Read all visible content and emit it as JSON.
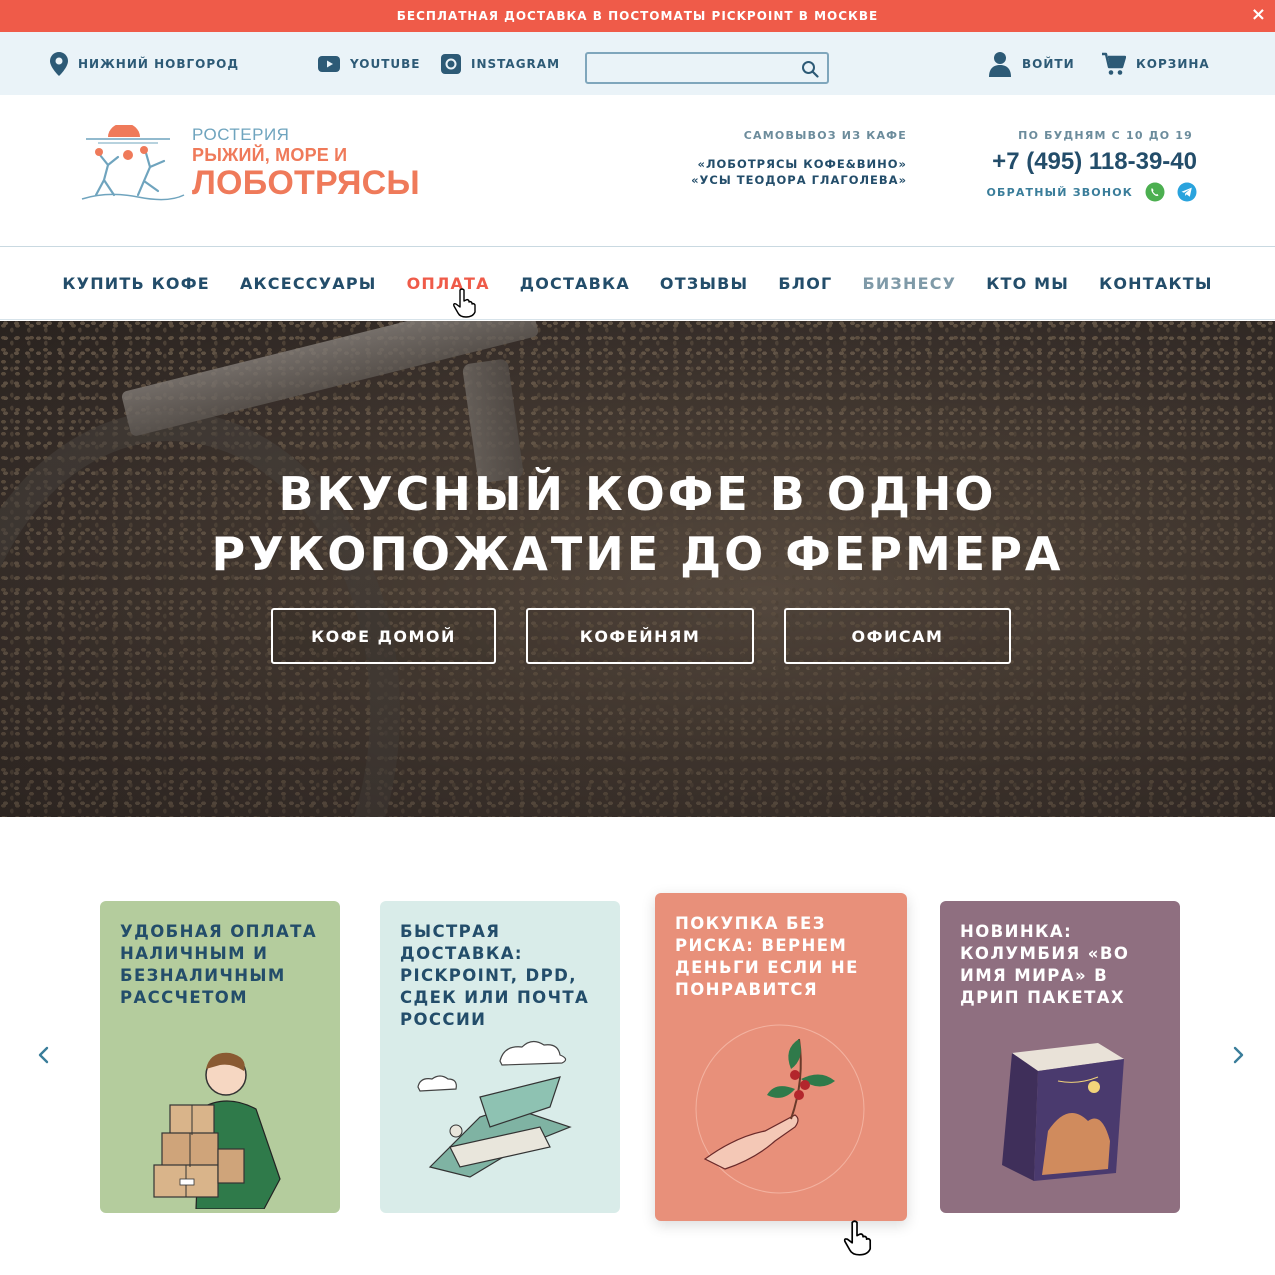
{
  "promo": {
    "text": "БЕСПЛАТНАЯ ДОСТАВКА В ПОСТОМАТЫ PICKPOINT В МОСКВЕ",
    "close": "×"
  },
  "topbar": {
    "city": "НИЖНИЙ НОВГОРОД",
    "youtube": "YOUTUBE",
    "instagram": "INSTAGRAM",
    "search_value": "",
    "login": "ВОЙТИ",
    "cart": "КОРЗИНА"
  },
  "header": {
    "logo_line1": "РОСТЕРИЯ",
    "logo_line2": "РЫЖИЙ, МОРЕ И",
    "logo_line3": "ЛОБОТРЯСЫ",
    "pickup_label": "САМОВЫВОЗ ИЗ КАФЕ",
    "cafe1": "«ЛОБОТРЯСЫ КОФЕ&ВИНО»",
    "cafe2": "«УСЫ ТЕОДОРА ГЛАГОЛЕВА»",
    "hours": "ПО БУДНЯМ С 10 ДО 19",
    "phone": "+7 (495) 118-39-40",
    "callback": "ОБРАТНЫЙ ЗВОНОК"
  },
  "nav": [
    "КУПИТЬ КОФЕ",
    "АКСЕССУАРЫ",
    "ОПЛАТА",
    "ДОСТАВКА",
    "ОТЗЫВЫ",
    "БЛОГ",
    "БИЗНЕСУ",
    "КТО МЫ",
    "КОНТАКТЫ"
  ],
  "hero": {
    "title_line1": "ВКУСНЫЙ КОФЕ В ОДНО",
    "title_line2": "РУКОПОЖАТИЕ ДО ФЕРМЕРА",
    "buttons": [
      "КОФЕ ДОМОЙ",
      "КОФЕЙНЯМ",
      "ОФИСАМ"
    ]
  },
  "cards": [
    {
      "title": "Удобная оплата наличным и безналичным рассчетом",
      "bg": "#b4cc9d",
      "fg": "#234d6a"
    },
    {
      "title": "Быстрая доставка: PickPoint, DPD, СДЕК или Почта России",
      "bg": "#d9ece9",
      "fg": "#234d6a"
    },
    {
      "title": "Покупка без риска: вернем деньги если не понравится",
      "bg": "#e8907a",
      "fg": "#ffffff"
    },
    {
      "title": "Новинка: Колумбия «Во имя мира» в дрип пакетах",
      "bg": "#8f6f80",
      "fg": "#ffffff"
    }
  ],
  "colors": {
    "accent": "#ef5b49",
    "primary": "#234d6a",
    "topbar_bg": "#eaf3f8"
  },
  "icons": [
    "location-pin-icon",
    "youtube-icon",
    "instagram-icon",
    "search-icon",
    "user-icon",
    "cart-icon",
    "whatsapp-icon",
    "telegram-icon",
    "chevron-left-icon",
    "chevron-right-icon",
    "hand-cursor-icon"
  ]
}
